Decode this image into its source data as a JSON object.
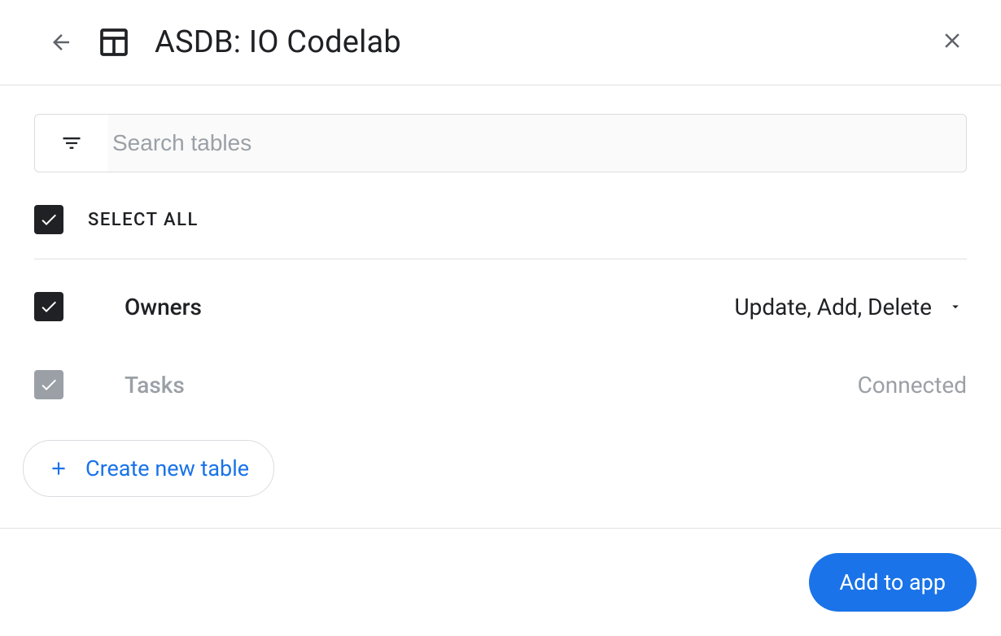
{
  "header": {
    "title": "ASDB: IO Codelab"
  },
  "search": {
    "placeholder": "Search tables"
  },
  "select_all": {
    "label": "SELECT ALL",
    "checked": true
  },
  "tables": [
    {
      "name": "Owners",
      "checked": true,
      "disabled": false,
      "status": "Update, Add, Delete",
      "has_dropdown": true
    },
    {
      "name": "Tasks",
      "checked": true,
      "disabled": true,
      "status": "Connected",
      "has_dropdown": false
    }
  ],
  "create_table": {
    "label": "Create new table"
  },
  "footer": {
    "add_to_app": "Add to app"
  }
}
